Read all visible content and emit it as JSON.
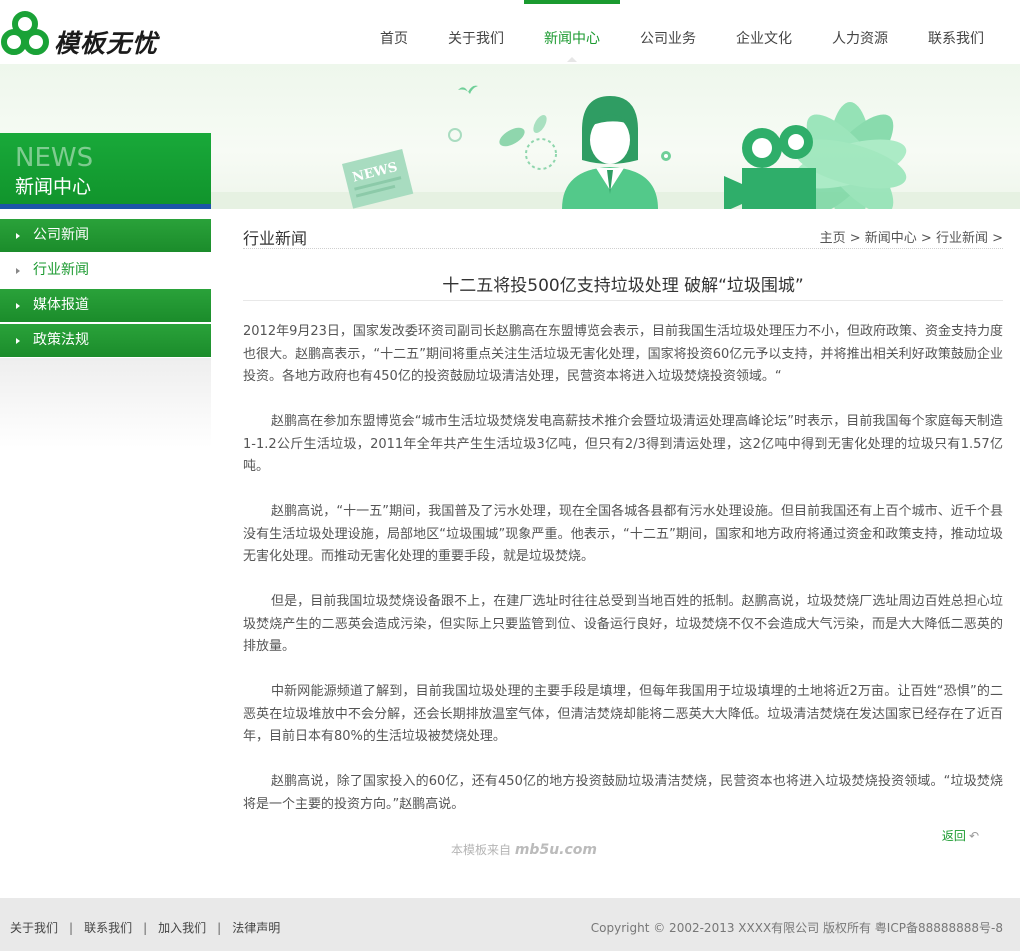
{
  "header": {
    "logo_text": "模板无忧",
    "nav": [
      {
        "label": "首页",
        "left": 0,
        "width": 68
      },
      {
        "label": "关于我们",
        "left": 0,
        "width": 96
      },
      {
        "label": "新闻中心",
        "left": 0,
        "width": 96,
        "active": true
      },
      {
        "label": "公司业务",
        "left": 0,
        "width": 96
      },
      {
        "label": "企业文化",
        "left": 0,
        "width": 96
      },
      {
        "label": "人力资源",
        "left": 0,
        "width": 96
      },
      {
        "label": "联系我们",
        "left": 0,
        "width": 96
      }
    ],
    "accent_color": "#1a9a2f"
  },
  "banner": {
    "news_en": "NEWS",
    "news_cn": "新闻中心",
    "paper_text": "NEWS"
  },
  "sidebar": {
    "items": [
      {
        "label": "公司新闻"
      },
      {
        "label": "行业新闻",
        "current": true
      },
      {
        "label": "媒体报道"
      },
      {
        "label": "政策法规"
      }
    ]
  },
  "main": {
    "section_title": "行业新闻",
    "breadcrumb": [
      "主页",
      "新闻中心",
      "行业新闻"
    ],
    "breadcrumb_sep": " > ",
    "article_title": "十二五将投500亿支持垃圾处理 破解“垃圾围城”",
    "paragraphs": [
      "2012年9月23日，国家发改委环资司副司长赵鹏高在东盟博览会表示，目前我国生活垃圾处理压力不小，但政府政策、资金支持力度也很大。赵鹏高表示，“十二五”期间将重点关注生活垃圾无害化处理，国家将投资60亿元予以支持，并将推出相关利好政策鼓励企业投资。各地方政府也有450亿的投资鼓励垃圾清洁处理，民营资本将进入垃圾焚烧投资领域。“",
      "赵鹏高在参加东盟博览会“城市生活垃圾焚烧发电高薪技术推介会暨垃圾清运处理高峰论坛”时表示，目前我国每个家庭每天制造1-1.2公斤生活垃圾，2011年全年共产生生活垃圾3亿吨，但只有2/3得到清运处理，这2亿吨中得到无害化处理的垃圾只有1.57亿吨。",
      "赵鹏高说，“十一五”期间，我国普及了污水处理，现在全国各城各县都有污水处理设施。但目前我国还有上百个城市、近千个县没有生活垃圾处理设施，局部地区“垃圾围城”现象严重。他表示，“十二五”期间，国家和地方政府将通过资金和政策支持，推动垃圾无害化处理。而推动无害化处理的重要手段，就是垃圾焚烧。",
      "但是，目前我国垃圾焚烧设备跟不上，在建厂选址时往往总受到当地百姓的抵制。赵鹏高说，垃圾焚烧厂选址周边百姓总担心垃圾焚烧产生的二恶英会造成污染，但实际上只要监管到位、设备运行良好，垃圾焚烧不仅不会造成大气污染，而是大大降低二恶英的排放量。",
      "中新网能源频道了解到，目前我国垃圾处理的主要手段是填埋，但每年我国用于垃圾填埋的土地将近2万亩。让百姓“恐惧”的二恶英在垃圾堆放中不会分解，还会长期排放温室气体，但清洁焚烧却能将二恶英大大降低。垃圾清洁焚烧在发达国家已经存在了近百年，目前日本有80%的生活垃圾被焚烧处理。",
      "赵鹏高说，除了国家投入的60亿，还有450亿的地方投资鼓励垃圾清洁焚烧，民营资本也将进入垃圾焚烧投资领域。“垃圾焚烧将是一个主要的投资方向。”赵鹏高说。"
    ],
    "back_label": "返回",
    "watermark_prefix": "本模板来自",
    "watermark_mark": "mb5u.com"
  },
  "footer": {
    "links": [
      "关于我们",
      "联系我们",
      "加入我们",
      "法律声明"
    ],
    "separator": "|",
    "copyright": "Copyright © 2002-2013 XXXX有限公司 版权所有  粤ICP备88888888号-8"
  }
}
